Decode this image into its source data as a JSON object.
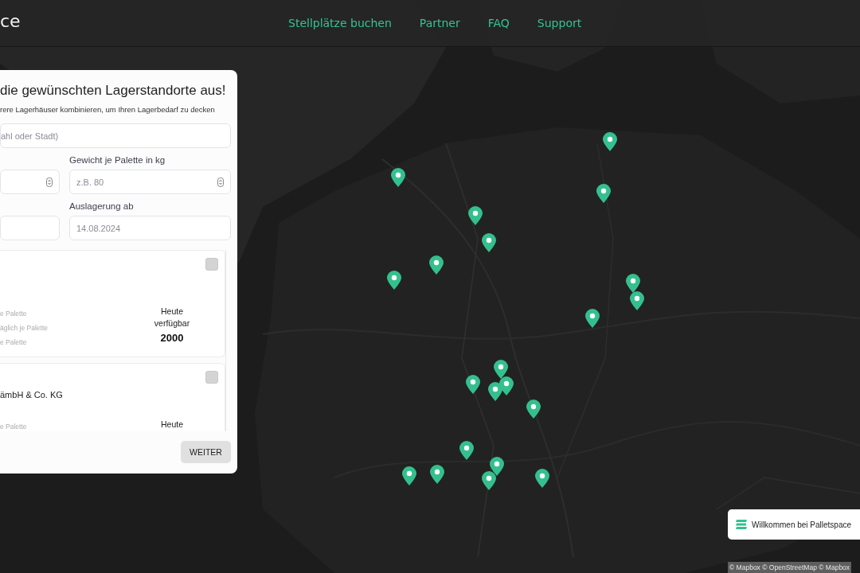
{
  "header": {
    "logo": "ce",
    "nav": [
      "Stellplätze buchen",
      "Partner",
      "FAQ",
      "Support"
    ]
  },
  "panel": {
    "title": "die gewünschten Lagerstandorte aus!",
    "subtitle": "rere Lagerhäuser kombinieren, um Ihren Lagerbedarf zu decken",
    "search": {
      "placeholder": "ahl oder Stadt)"
    },
    "rows": [
      {
        "left": {
          "kind": "number"
        },
        "right": {
          "label": "Gewicht je Palette in kg",
          "kind": "number",
          "placeholder": "z.B. 80"
        }
      },
      {
        "left": {
          "kind": "date"
        },
        "right": {
          "label": "Auslagerung ab",
          "kind": "date",
          "placeholder": "14.08.2024"
        }
      }
    ],
    "cards": [
      {
        "checked": false,
        "lines": [
          "e Palette",
          "äglich je Palette",
          "e Palette"
        ],
        "availability": "Heute verfügbar",
        "count": "2000"
      },
      {
        "checked": false,
        "name": "ämbH & Co. KG",
        "lines": [
          "e Palette"
        ],
        "availability": "Heute"
      }
    ],
    "button": "WEITER"
  },
  "toast": "Willkommen bei Palletspace",
  "attribution": "© Mapbox © OpenStreetMap © Mapbox"
}
